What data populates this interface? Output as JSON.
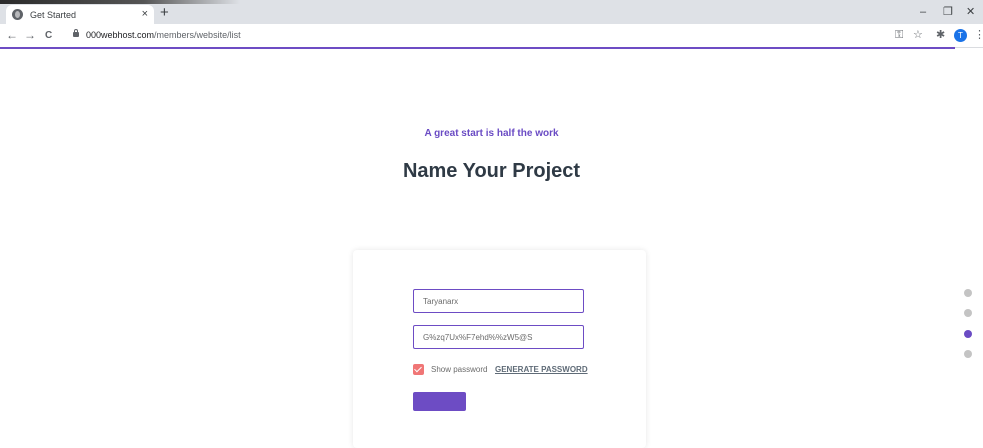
{
  "browser": {
    "tab_title": "Get Started",
    "tab_close": "×",
    "new_tab": "+",
    "minimize": "–",
    "restore": "❐",
    "close": "✕",
    "back": "←",
    "forward": "→",
    "reload": "C",
    "url_host": "000webhost.com",
    "url_path": "/members/website/list",
    "avatar_letter": "T"
  },
  "page": {
    "subtitle": "A great start is half the work",
    "title": "Name Your Project"
  },
  "form": {
    "name_value": "Taryanarx",
    "password_value": "G%zq7Ux%F7ehd%%zW5@S",
    "show_password_label": "Show password",
    "generate_password_label": "GENERATE PASSWORD",
    "show_password_checked": true
  },
  "stepper": {
    "count": 4,
    "active_index": 2
  },
  "colors": {
    "accent": "#6a4bc4",
    "checkbox": "#f07676",
    "heading": "#2f3a45"
  }
}
